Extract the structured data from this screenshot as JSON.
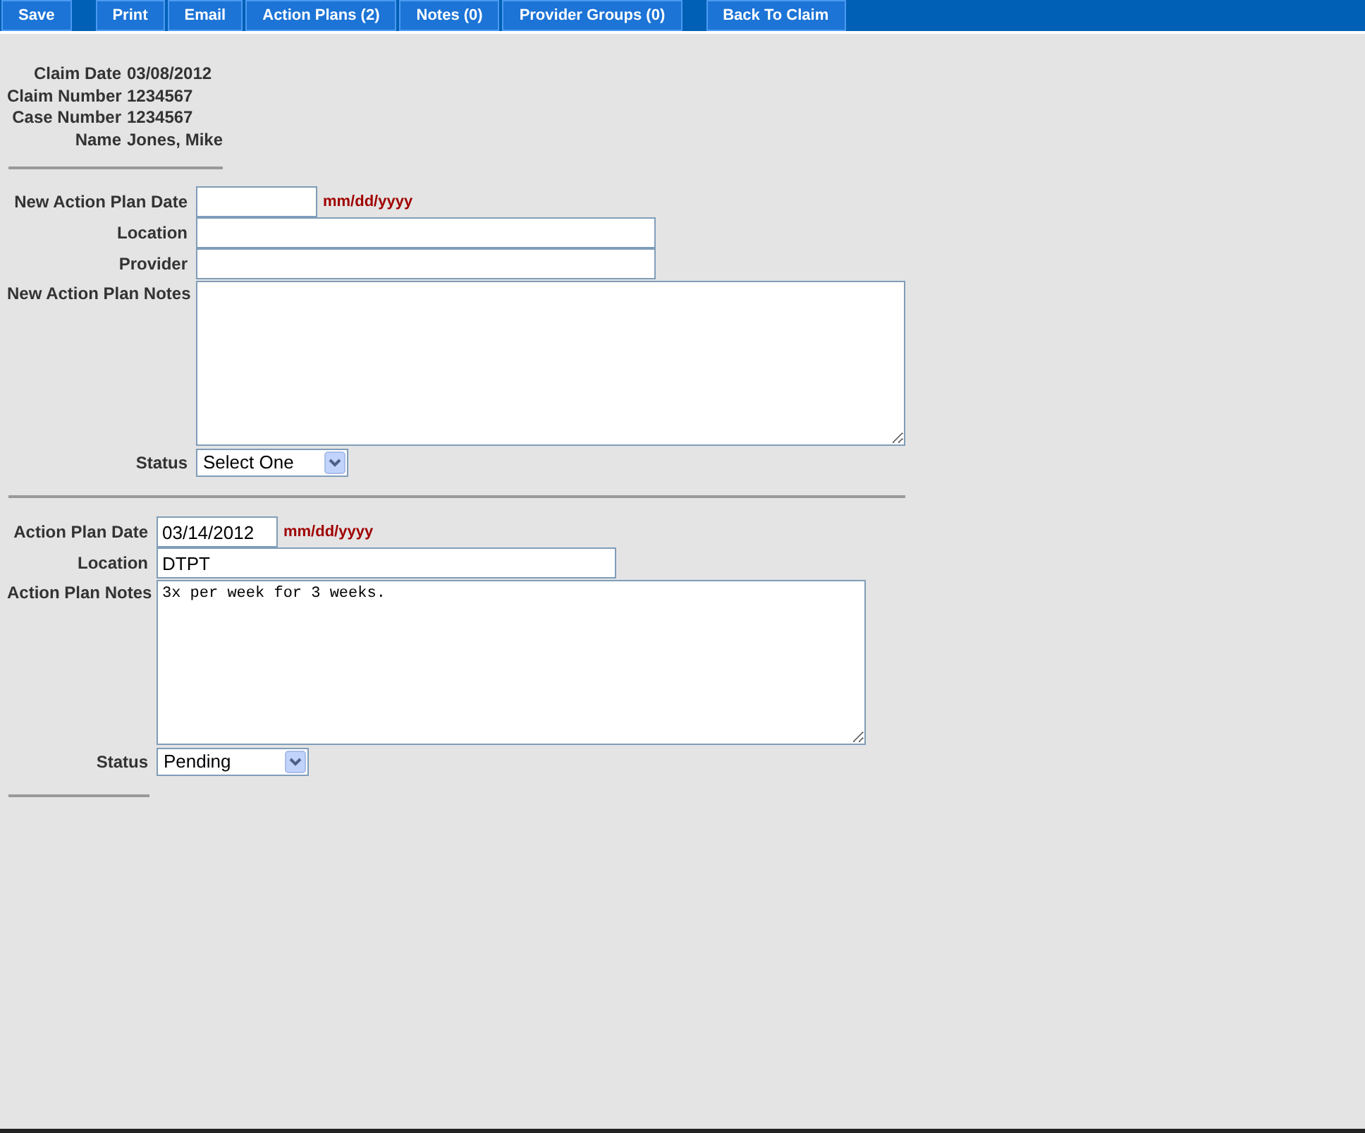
{
  "toolbar": {
    "groups": [
      {
        "buttons": [
          "Save"
        ]
      },
      {
        "buttons": [
          "Print",
          "Email",
          "Action Plans (2)",
          "Notes (0)",
          "Provider Groups (0)"
        ]
      },
      {
        "buttons": [
          "Back To Claim"
        ]
      }
    ]
  },
  "claim_info": [
    {
      "label": "Claim Date",
      "value": "03/08/2012"
    },
    {
      "label": "Claim Number",
      "value": "1234567"
    },
    {
      "label": "Case Number",
      "value": "1234567"
    },
    {
      "label": "Name",
      "value": "Jones, Mike"
    }
  ],
  "new_action_plan": {
    "fields": [
      {
        "kind": "date",
        "label": "New Action Plan Date",
        "hint": "mm/dd/yyyy"
      },
      {
        "kind": "text",
        "label": "Location"
      },
      {
        "kind": "text",
        "label": "Provider"
      },
      {
        "kind": "textarea",
        "label": "New Action Plan Notes"
      },
      {
        "kind": "select",
        "label": "Status",
        "value": "Select One"
      }
    ]
  },
  "action_plans": [
    {
      "fields": [
        {
          "kind": "date",
          "label": "Action Plan Date",
          "value": "03/14/2012",
          "hint": "mm/dd/yyyy"
        },
        {
          "kind": "text",
          "label": "Location",
          "value": "DTPT"
        },
        {
          "kind": "textarea",
          "label": "Action Plan Notes",
          "value": "3x per week for 3 weeks."
        },
        {
          "kind": "select",
          "label": "Status",
          "value": "Pending"
        }
      ]
    }
  ]
}
